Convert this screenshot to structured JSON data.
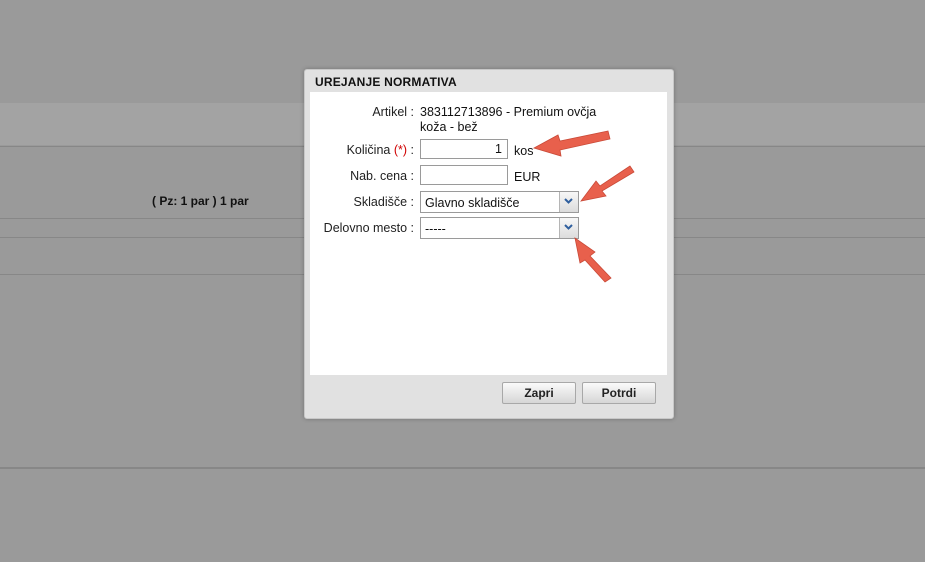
{
  "background": {
    "text": "( Pz: 1 par ) 1 par"
  },
  "dialog": {
    "title": "UREJANJE NORMATIVA",
    "fields": {
      "artikel": {
        "label": "Artikel :",
        "value_line1": "383112713896 - Premium ovčja",
        "value_line2": "koža - bež"
      },
      "kolicina": {
        "label": "Količina",
        "required_mark": "(*)",
        "label_suffix": " :",
        "value": "1",
        "unit": "kos"
      },
      "nab_cena": {
        "label": "Nab. cena :",
        "value": "",
        "unit": "EUR"
      },
      "skladisce": {
        "label": "Skladišče :",
        "selected": "Glavno skladišče"
      },
      "delovno_mesto": {
        "label": "Delovno mesto :",
        "selected": "-----"
      }
    },
    "buttons": {
      "close": "Zapri",
      "confirm": "Potrdi"
    }
  },
  "colors": {
    "annotation_arrow": "#e8604c",
    "required": "#d00000"
  }
}
